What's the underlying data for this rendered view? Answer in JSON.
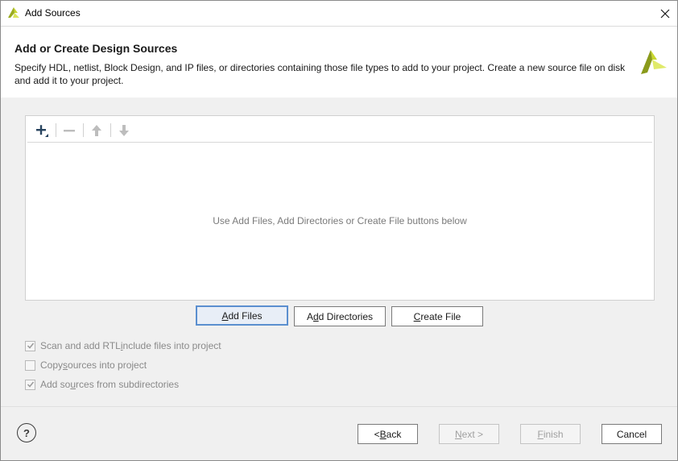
{
  "window": {
    "title": "Add Sources"
  },
  "header": {
    "title": "Add or Create Design Sources",
    "description": "Specify HDL, netlist, Block Design, and IP files, or directories containing those file types to add to your project. Create a new source file on disk and add it to your project."
  },
  "toolbar": {
    "icons": [
      "add-icon",
      "remove-icon",
      "move-up-icon",
      "move-down-icon"
    ]
  },
  "file_list": {
    "empty_message": "Use Add Files, Add Directories or Create File buttons below"
  },
  "action_buttons": {
    "add_files": {
      "pre": "",
      "key": "A",
      "post": "dd Files"
    },
    "add_directories": {
      "pre": "A",
      "key": "d",
      "post": "d Directories"
    },
    "create_file": {
      "pre": "",
      "key": "C",
      "post": "reate File"
    }
  },
  "options": [
    {
      "pre": "Scan and add RTL ",
      "key": "i",
      "post": "nclude files into project",
      "checked": true,
      "enabled": false
    },
    {
      "pre": "Copy ",
      "key": "s",
      "post": "ources into project",
      "checked": false,
      "enabled": false
    },
    {
      "pre": "Add so",
      "key": "u",
      "post": "rces from subdirectories",
      "checked": true,
      "enabled": false
    }
  ],
  "footer": {
    "help_label": "?",
    "back": {
      "pre": "< ",
      "key": "B",
      "post": "ack"
    },
    "next": {
      "pre": "",
      "key": "N",
      "post": "ext >"
    },
    "finish": {
      "pre": "",
      "key": "F",
      "post": "inish"
    },
    "cancel": "Cancel"
  },
  "colors": {
    "brand_yellow": "#c8d62e",
    "brand_olive": "#8a9a1b",
    "focus_border": "#5b8fcf"
  }
}
